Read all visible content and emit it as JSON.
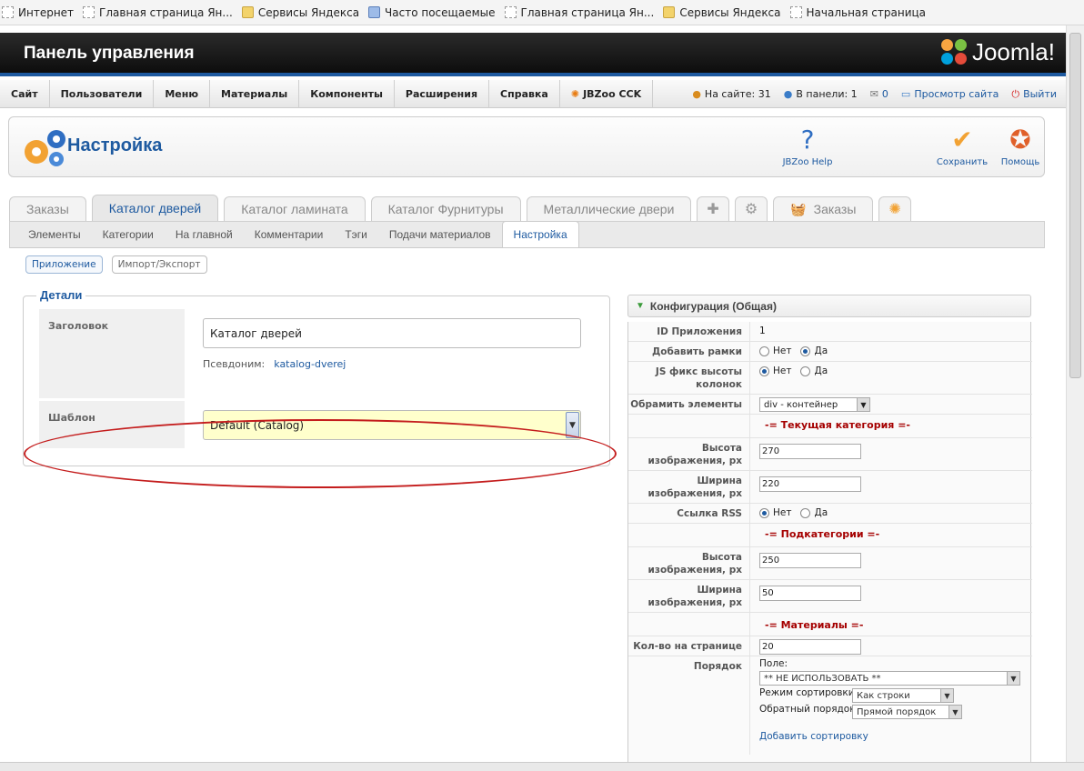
{
  "bookmarks": [
    {
      "label": "Интернет",
      "icon": "page-icon"
    },
    {
      "label": "Главная страница Ян...",
      "icon": "page-icon"
    },
    {
      "label": "Сервисы Яндекса",
      "icon": "folder-icon"
    },
    {
      "label": "Часто посещаемые",
      "icon": "star-icon"
    },
    {
      "label": "Главная страница Ян...",
      "icon": "page-icon"
    },
    {
      "label": "Сервисы Яндекса",
      "icon": "folder-icon"
    },
    {
      "label": "Начальная страница",
      "icon": "page-icon"
    }
  ],
  "header": {
    "title": "Панель управления",
    "logo_text": "Joomla!"
  },
  "menu": [
    "Сайт",
    "Пользователи",
    "Меню",
    "Материалы",
    "Компоненты",
    "Расширения",
    "Справка",
    "JBZoo CCK"
  ],
  "status": {
    "online_site": "На сайте: 31",
    "online_admin": "В панели: 1",
    "messages": "0",
    "view_site": "Просмотр сайта",
    "logout": "Выйти"
  },
  "toolbar": {
    "title": "Настройка",
    "help": "JBZoo Help",
    "save": "Сохранить",
    "assist": "Помощь"
  },
  "tabs": [
    "Заказы",
    "Каталог дверей",
    "Каталог ламината",
    "Каталог Фурнитуры",
    "Металлические двери"
  ],
  "tab_extra": "Заказы",
  "subtabs": [
    "Элементы",
    "Категории",
    "На главной",
    "Комментарии",
    "Тэги",
    "Подачи материалов",
    "Настройка"
  ],
  "pills": [
    "Приложение",
    "Импорт/Экспорт"
  ],
  "details": {
    "legend": "Детали",
    "title_label": "Заголовок",
    "title_value": "Каталог дверей",
    "alias_label": "Псевдоним:",
    "alias_value": "katalog-dverej",
    "template_label": "Шаблон",
    "template_value": "Default (Catalog)"
  },
  "config": {
    "heading": "Конфигурация (Общая)",
    "app_id_label": "ID Приложения",
    "app_id": "1",
    "frames_label": "Добавить рамки",
    "js_fix_label": "JS фикс высоты колонок",
    "wrap_label": "Обрамить элементы",
    "wrap_value": "div - контейнер",
    "no": "Нет",
    "yes": "Да",
    "section_current": "-= Текущая категория =-",
    "section_sub": "-= Подкатегории =-",
    "section_items": "-= Материалы =-",
    "img_height_label": "Высота изображения, px",
    "img_width_label": "Ширина изображения, px",
    "rss_label": "Ссылка RSS",
    "cur_height": "270",
    "cur_width": "220",
    "sub_height": "250",
    "sub_width": "50",
    "per_page_label": "Кол-во на странице",
    "per_page": "20",
    "order_label": "Порядок",
    "field_label": "Поле:",
    "field_value": "** НЕ ИСПОЛЬЗОВАТЬ **",
    "sort_mode_label": "Режим сортировки:",
    "sort_mode_value": "Как строки",
    "reverse_label": "Обратный порядок:",
    "reverse_value": "Прямой порядок",
    "add_sort": "Добавить сортировку"
  },
  "colors": {
    "accent": "#1e5aa0",
    "highlight_ellipse": "#c41d1d",
    "section_red": "#a50000"
  }
}
